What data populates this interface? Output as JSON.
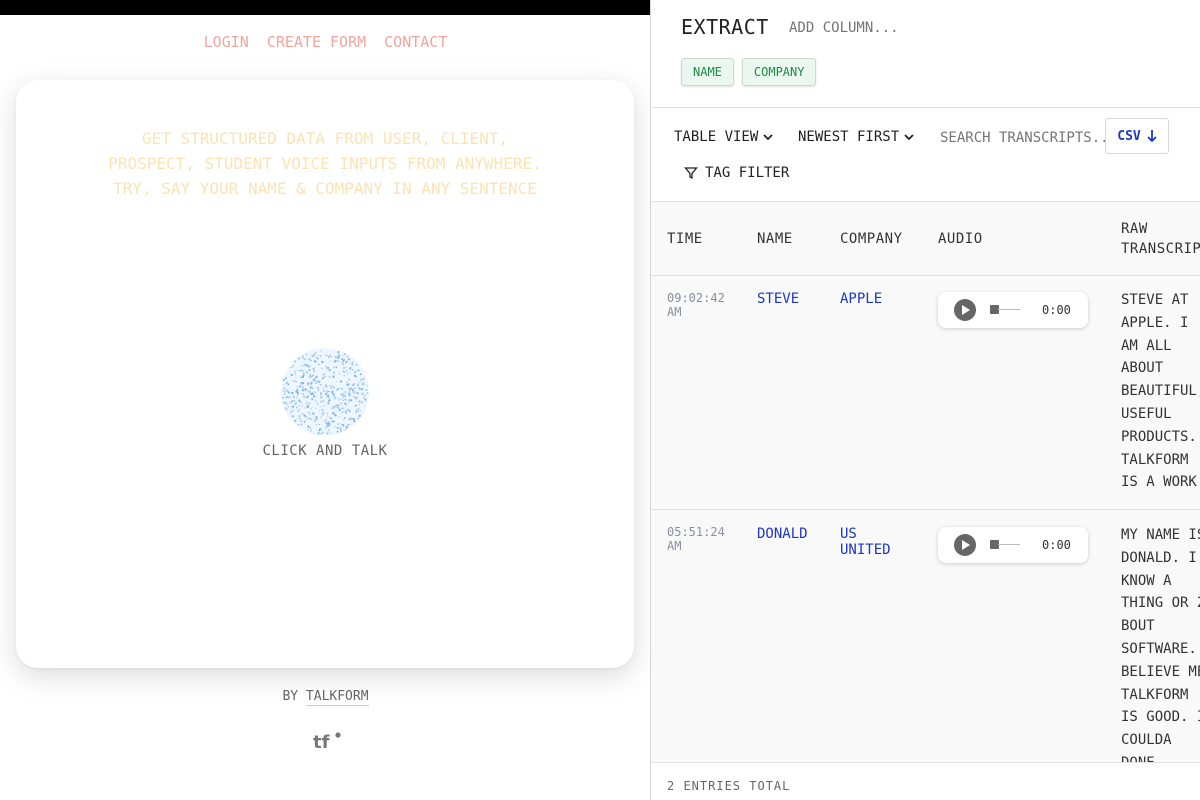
{
  "nav": {
    "login": "Login",
    "create_form": "Create Form",
    "contact": "Contact"
  },
  "hero": {
    "tagline_lines": [
      "Get structured data from user, client,",
      "prospect, student voice inputs from anywhere.",
      "Try, say your name & company in any sentence"
    ],
    "orb_label": "Click and Talk"
  },
  "byline": {
    "prefix": "By ",
    "brand": "Talkform"
  },
  "logo": {
    "text": "tf",
    "icon": "talkform-logo-icon"
  },
  "panel": {
    "title": "Extract",
    "add_column_placeholder": "Add column...",
    "chips": [
      "Name",
      "Company"
    ],
    "view_select": "Table View",
    "sort_select": "Newest First",
    "search_placeholder": "Search transcripts...",
    "csv_label": "CSV",
    "tag_filter": "Tag Filter",
    "columns": {
      "time": "Time",
      "name": "Name",
      "company": "Company",
      "audio": "Audio",
      "raw": "Raw Transcript"
    },
    "rows": [
      {
        "time": "09:02:42 AM",
        "name": "Steve",
        "company": "Apple",
        "audio_time": "0:00",
        "transcript": "Steve at Apple. I am all about beautiful, useful products. Talkform is a work of art"
      },
      {
        "time": "05:51:24 AM",
        "name": "Donald",
        "company": "US United",
        "audio_time": "0:00",
        "transcript": "My name is Donald. I know a thing or 2 bout software. Believe me Talkform is good. I coulda done better but"
      }
    ],
    "footer": "2 entries total"
  },
  "colors": {
    "accent_blue": "#1b37c9",
    "nav_pink": "#f2a49d",
    "chip_green": "#1e8a43",
    "tagline_yellow": "#fbe3b3"
  }
}
